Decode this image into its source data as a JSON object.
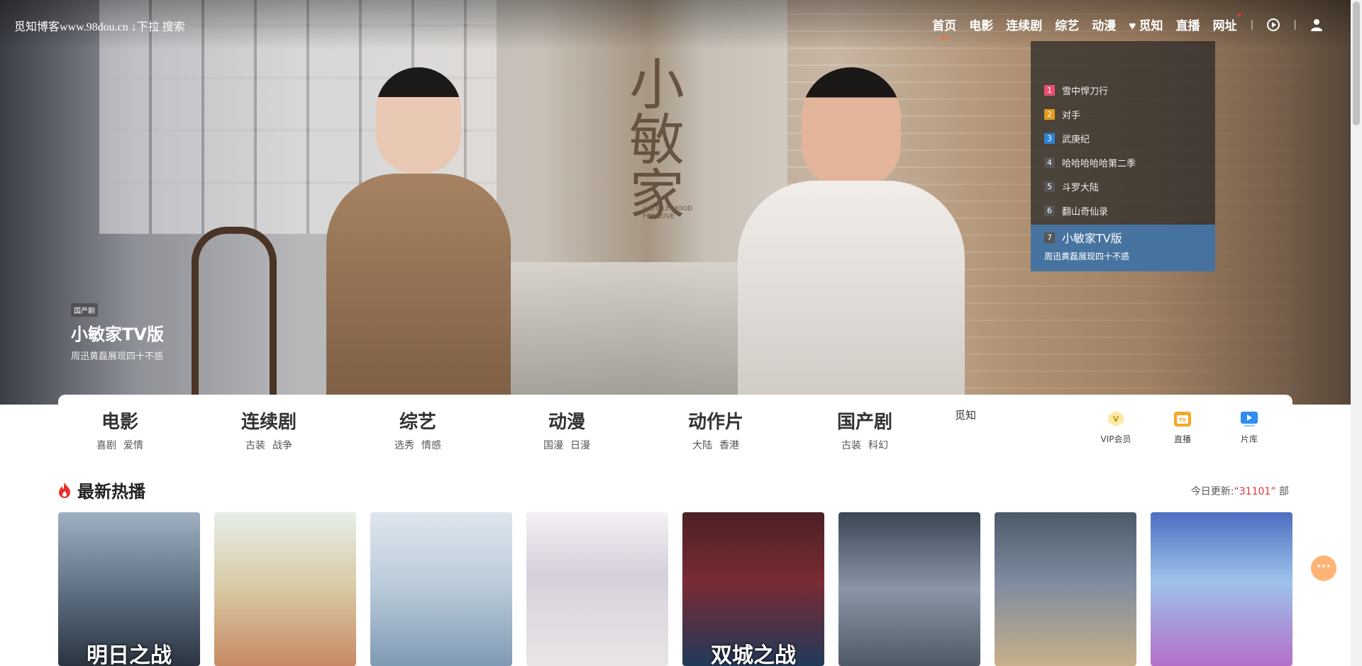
{
  "header": {
    "brand": "觅知博客www.98dou.cn ↓下拉 搜索",
    "nav": [
      "首页",
      "电影",
      "连续剧",
      "综艺",
      "动漫",
      "觅知",
      "直播",
      "网址"
    ]
  },
  "hero": {
    "calligraphy": "小敏家",
    "calligraphy_sub": "A LITTLE MOOD FOR LOVE",
    "tag": "国产剧",
    "title": "小敏家TV版",
    "subtitle": "周迅黄磊展现四十不惑"
  },
  "ranking": {
    "items": [
      {
        "num": "1",
        "title": "雪中悍刀行"
      },
      {
        "num": "2",
        "title": "对手"
      },
      {
        "num": "3",
        "title": "武庚纪"
      },
      {
        "num": "4",
        "title": "哈哈哈哈哈第二季"
      },
      {
        "num": "5",
        "title": "斗罗大陆"
      },
      {
        "num": "6",
        "title": "翻山奇仙录"
      }
    ],
    "active": {
      "num": "7",
      "title": "小敏家TV版",
      "subtitle": "周迅黄磊展现四十不惑"
    }
  },
  "categories": [
    {
      "title": "电影",
      "subs": [
        "喜剧",
        "爱情"
      ]
    },
    {
      "title": "连续剧",
      "subs": [
        "古装",
        "战争"
      ]
    },
    {
      "title": "综艺",
      "subs": [
        "选秀",
        "情感"
      ]
    },
    {
      "title": "动漫",
      "subs": [
        "国漫",
        "日漫"
      ]
    },
    {
      "title": "动作片",
      "subs": [
        "大陆",
        "香港"
      ]
    },
    {
      "title": "国产剧",
      "subs": [
        "古装",
        "科幻"
      ]
    }
  ],
  "extra_link": "觅知",
  "tools": [
    {
      "label": "VIP会员",
      "icon": "vip-icon",
      "color": "#f5c54a"
    },
    {
      "label": "直播",
      "icon": "tv-icon",
      "color": "#f5a623"
    },
    {
      "label": "片库",
      "icon": "play-library-icon",
      "color": "#2f8cf0"
    }
  ],
  "hot": {
    "title": "最新热播",
    "today_label": "今日更新:",
    "today_count": "“31101”",
    "today_unit": "部",
    "posters": [
      {
        "caption": "明日之战"
      },
      {
        "caption": ""
      },
      {
        "caption": ""
      },
      {
        "caption": ""
      },
      {
        "caption": "双城之战"
      },
      {
        "caption": ""
      },
      {
        "caption": ""
      },
      {
        "caption": ""
      }
    ]
  },
  "colors": {
    "accent": "#ff6a2e",
    "rank_active": "#4682be",
    "today_count": "#dd3333"
  }
}
